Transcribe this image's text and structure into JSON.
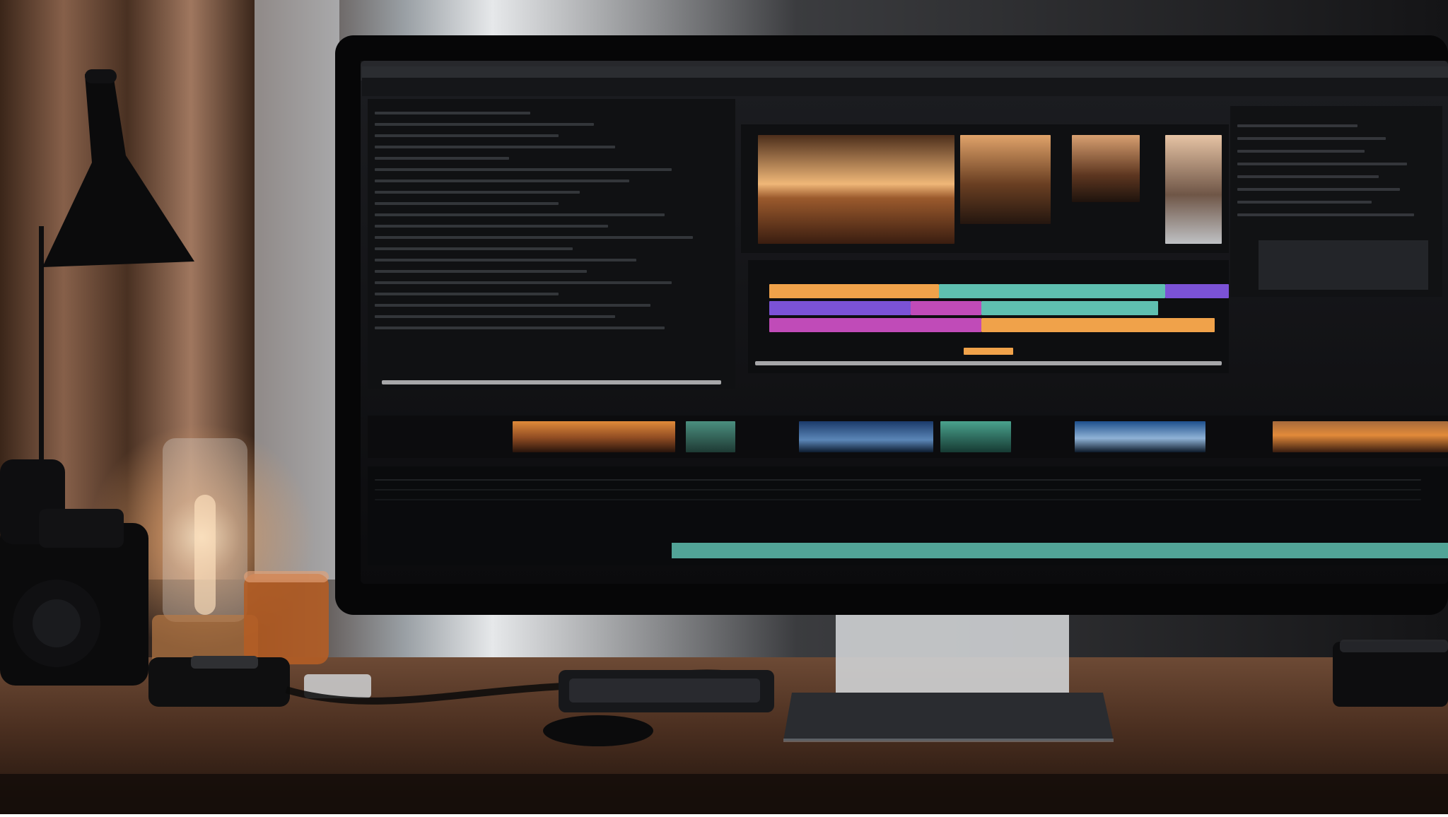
{
  "scene": {
    "alt": "",
    "colors": {
      "wall": "#1d1c1c",
      "curtain": "#7a5a46",
      "desk": "#4a2f1f",
      "monitor_bezel": "#0a0a0b",
      "screen_bg": "#121316",
      "teal": "#5fbfb0",
      "orange": "#f0a24a",
      "purple": "#7b52d6",
      "magenta": "#c04bb8",
      "green": "#74c08a"
    }
  },
  "ui": {
    "menu_items": [
      "",
      "",
      "",
      "",
      "",
      "",
      ""
    ],
    "panels": {
      "code": "",
      "preview": "",
      "timeline": "",
      "inspector": ""
    }
  }
}
